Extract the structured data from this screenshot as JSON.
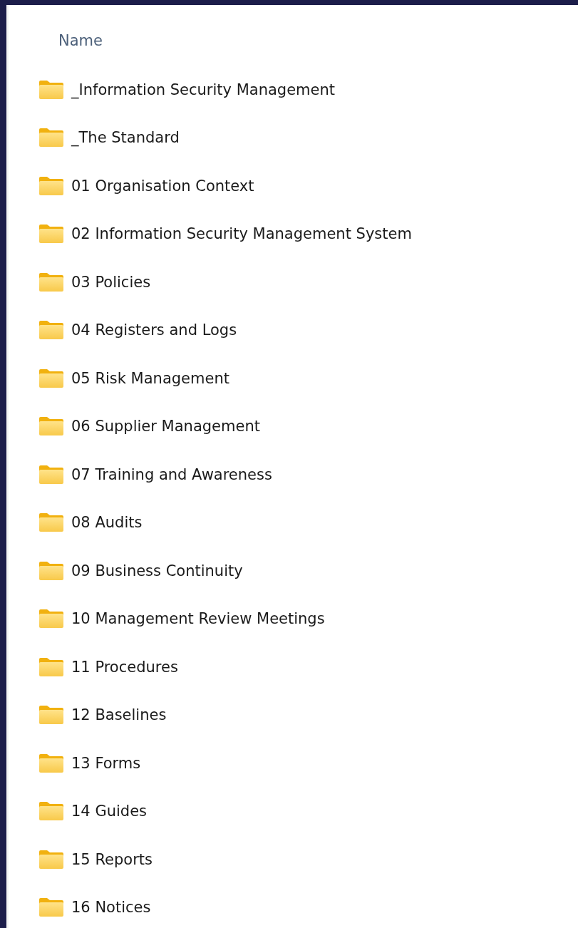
{
  "column_header": "Name",
  "folders": [
    {
      "name": "_Information Security Management"
    },
    {
      "name": "_The Standard"
    },
    {
      "name": "01 Organisation Context"
    },
    {
      "name": "02 Information Security Management System"
    },
    {
      "name": "03 Policies"
    },
    {
      "name": "04 Registers and Logs"
    },
    {
      "name": "05 Risk Management"
    },
    {
      "name": "06 Supplier Management"
    },
    {
      "name": "07 Training and Awareness"
    },
    {
      "name": "08 Audits"
    },
    {
      "name": "09 Business Continuity"
    },
    {
      "name": "10 Management Review Meetings"
    },
    {
      "name": "11 Procedures"
    },
    {
      "name": "12 Baselines"
    },
    {
      "name": "13 Forms"
    },
    {
      "name": "14 Guides"
    },
    {
      "name": "15 Reports"
    },
    {
      "name": "16 Notices"
    }
  ]
}
